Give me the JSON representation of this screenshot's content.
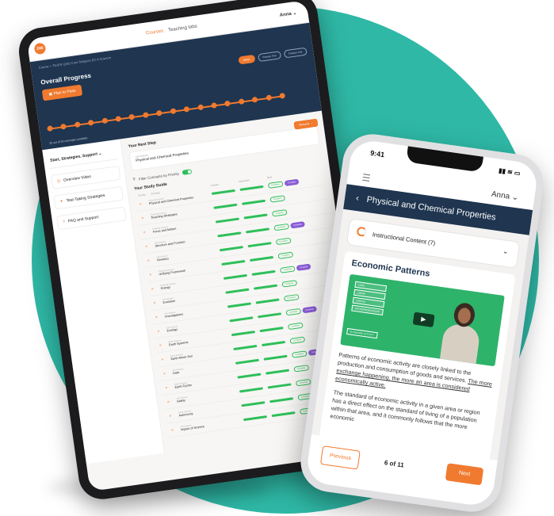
{
  "colors": {
    "accent": "#f07a2f",
    "navy": "#1f3550",
    "teal": "#2fb8a6",
    "green": "#2fbf5a",
    "purple": "#8a5cd6"
  },
  "tablet": {
    "logo": "240",
    "nav": [
      "Courses",
      "Teaching tabs"
    ],
    "user": "Anna",
    "breadcrumb": "Course  >  TExES (240) Core Subjects EC-6 Science",
    "hero_title": "Overall Progress",
    "plan_button": "Plan to Pass",
    "pills": [
      "Badge",
      "Practice Test",
      "Practice Test"
    ],
    "progress_count": "20 out of 30 concepts complete",
    "progress": {
      "completed": 20,
      "total": 30
    },
    "sidebar_heading": "Start, Strategies, Support",
    "sidebar_items": [
      "Overview Video",
      "Test-Taking Strategies",
      "FAQ and Support"
    ],
    "next_step_title": "Your Next Step",
    "next_step_sub": "Life Science",
    "next_step_name": "Physical and Chemical Properties",
    "resume_button": "Resume",
    "filter_label": "Filter Concepts by Priority",
    "study_guide_title": "Your Study Guide",
    "columns": [
      "Priority",
      "Concept",
      "Content",
      "Instruction",
      "Quiz"
    ],
    "rows": [
      {
        "sub": "Physical Science",
        "name": "Physical and Chemical Properties"
      },
      {
        "sub": "Physical Science",
        "name": "Teaching Strategies"
      },
      {
        "sub": "Physical Science",
        "name": "Force and Motion"
      },
      {
        "sub": "Life Science",
        "name": "Structure and Function"
      },
      {
        "sub": "Life Science",
        "name": "Genetics"
      },
      {
        "sub": "Physical Science",
        "name": "Unifying Framework"
      },
      {
        "sub": "Physical Science",
        "name": "Energy"
      },
      {
        "sub": "Life Science",
        "name": "Evolution"
      },
      {
        "sub": "Life Science",
        "name": "Investigations"
      },
      {
        "sub": "Life Science",
        "name": "Ecology"
      },
      {
        "sub": "Earth Science",
        "name": "Earth Systems"
      },
      {
        "sub": "Earth Science",
        "name": "Earth-Moon-Sun"
      },
      {
        "sub": "Life Science",
        "name": "Data"
      },
      {
        "sub": "Earth Science",
        "name": "Earth Cycles"
      },
      {
        "sub": "Life Science",
        "name": "Safety"
      },
      {
        "sub": "Earth Science",
        "name": "Astronomy"
      },
      {
        "sub": "Life Science",
        "name": "Impact of Science"
      }
    ],
    "tag_labels": [
      "Complete",
      "Complete"
    ]
  },
  "phone": {
    "time": "9:41",
    "signal": "▮▮ ≋ ▭",
    "user": "Anna",
    "title": "Physical and Chemical Properties",
    "card_label": "Instructional Content (7)",
    "heading": "Economic Patterns",
    "video_labels": [
      "LAND",
      "LABOR",
      "CAPITAL",
      "ENTREPRENEURSHIP"
    ],
    "video_tag": "ECONOMIC ACTIVITY",
    "para1_plain": "Patterns of economic activity are closely linked to the production and consumption of goods and services. ",
    "para1_underlined": "The more exchange happening, the more an area is considered economically active.",
    "para2": "The standard of economic activity in a given area or region has a direct effect on the standard of living of a population within that area, and it commonly follows that the more economic",
    "prev_button": "Previous",
    "page_indicator": "6 of 11",
    "next_button": "Next"
  }
}
